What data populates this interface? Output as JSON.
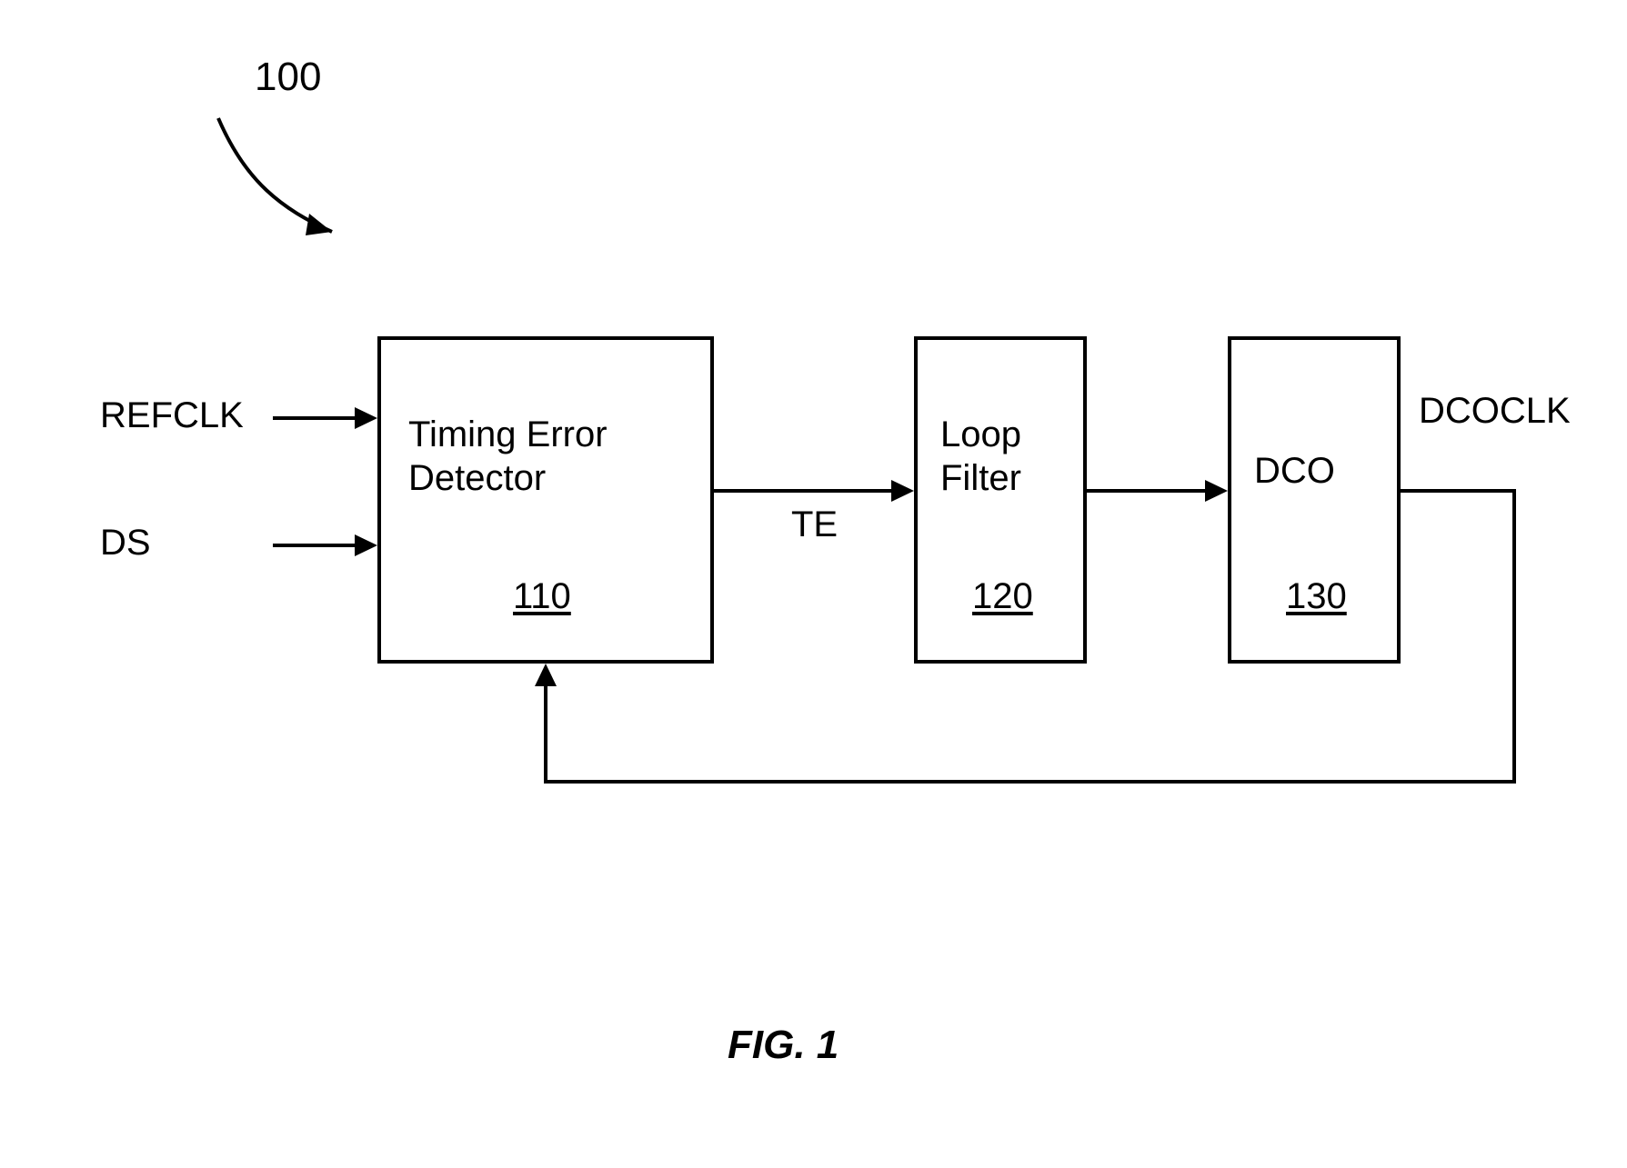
{
  "figure": {
    "reference_number": "100",
    "caption": "FIG. 1"
  },
  "blocks": {
    "ted": {
      "title": "Timing Error\nDetector",
      "ref": "110"
    },
    "lf": {
      "title": "Loop\nFilter",
      "ref": "120"
    },
    "dco": {
      "title": "DCO",
      "ref": "130"
    }
  },
  "signals": {
    "refclk": "REFCLK",
    "ds": "DS",
    "te": "TE",
    "dcoclk": "DCOCLK"
  }
}
